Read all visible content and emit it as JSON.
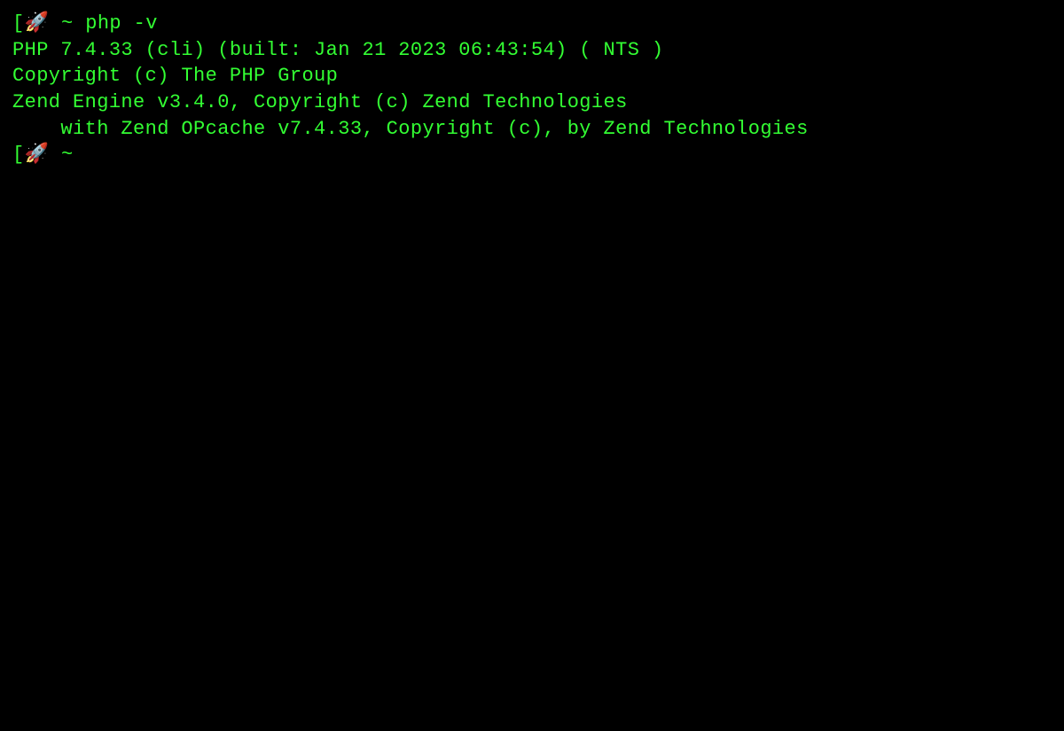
{
  "terminal": {
    "prompt1": {
      "bracket": "[",
      "rocket": "🚀",
      "tilde": " ~ ",
      "command": "php -v"
    },
    "output": {
      "line1": "PHP 7.4.33 (cli) (built: Jan 21 2023 06:43:54) ( NTS )",
      "line2": "Copyright (c) The PHP Group",
      "line3": "Zend Engine v3.4.0, Copyright (c) Zend Technologies",
      "line4": "    with Zend OPcache v7.4.33, Copyright (c), by Zend Technologies"
    },
    "prompt2": {
      "bracket": "[",
      "rocket": "🚀",
      "tilde": " ~ "
    }
  }
}
